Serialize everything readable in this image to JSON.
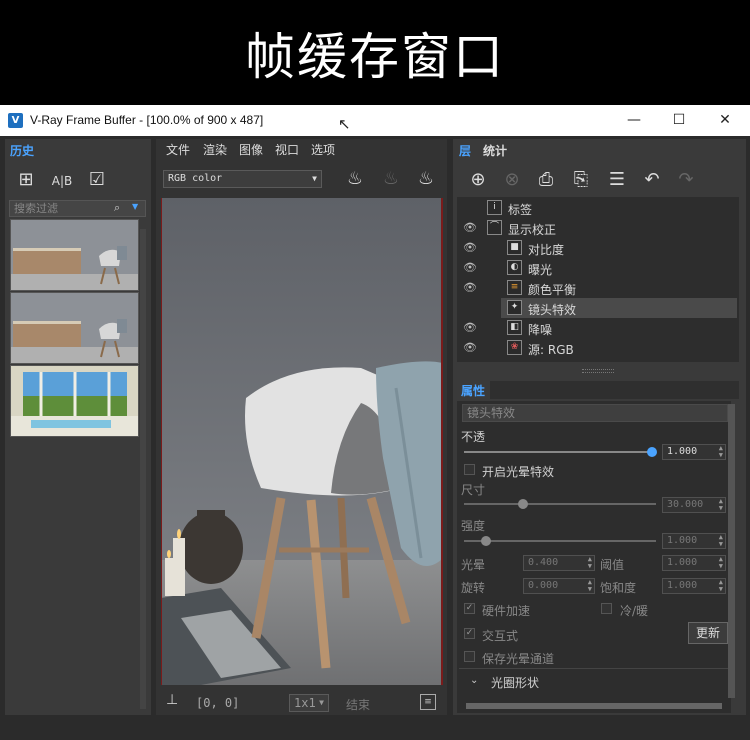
{
  "banner": {
    "title": "帧缓存窗口"
  },
  "window": {
    "title": "V-Ray Frame Buffer - [100.0% of 900 x 487]",
    "controls": {
      "minimize": "—",
      "maximize": "☐",
      "close": "✕"
    }
  },
  "history": {
    "tab_label": "历史",
    "search_placeholder": "搜索过滤",
    "thumbnails": [
      "chair-scene-1",
      "chair-scene-2",
      "pool-scene"
    ]
  },
  "center": {
    "menu": [
      "文件",
      "渲染",
      "图像",
      "视口",
      "选项"
    ],
    "channel_select": "RGB color",
    "status": {
      "coords": "[0, 0]",
      "zoom": "1x1",
      "state": "结束"
    }
  },
  "layers": {
    "tabs": [
      "层",
      "统计"
    ],
    "items": [
      {
        "label": "标签",
        "icon": "i",
        "eye": false,
        "indent": 0
      },
      {
        "label": "显示校正",
        "icon": "⌒",
        "eye": true,
        "indent": 0
      },
      {
        "label": "对比度",
        "icon": "■",
        "eye": true,
        "indent": 1
      },
      {
        "label": "曝光",
        "icon": "◐",
        "eye": true,
        "indent": 1
      },
      {
        "label": "颜色平衡",
        "icon": "≡",
        "eye": true,
        "indent": 1
      },
      {
        "label": "镜头特效",
        "icon": "✦",
        "eye": false,
        "indent": 1,
        "selected": true
      },
      {
        "label": "降噪",
        "icon": "◧",
        "eye": true,
        "indent": 1
      },
      {
        "label": "源: RGB",
        "icon": "❀",
        "eye": true,
        "indent": 1
      }
    ]
  },
  "properties": {
    "header": "属性",
    "section": "镜头特效",
    "opacity_label": "不透",
    "opacity_value": "1.000",
    "enable_bloom": "开启光晕特效",
    "size_label": "尺寸",
    "size_value": "30.000",
    "intensity_label": "强度",
    "intensity_value": "1.000",
    "bloom_label": "光晕",
    "bloom_value": "0.400",
    "threshold_label": "阈值",
    "threshold_value": "1.000",
    "rotation_label": "旋转",
    "rotation_value": "0.000",
    "saturation_label": "饱和度",
    "saturation_value": "1.000",
    "hw_accel": "硬件加速",
    "cold_warm": "冷/暖",
    "interactive": "交互式",
    "update_button": "更新",
    "save_bloom_channel": "保存光晕通道",
    "aperture_section": "光圈形状"
  },
  "colors": {
    "accent": "#4aa3ff",
    "bg": "#2b2b2b",
    "panel": "#3a3a3a"
  }
}
